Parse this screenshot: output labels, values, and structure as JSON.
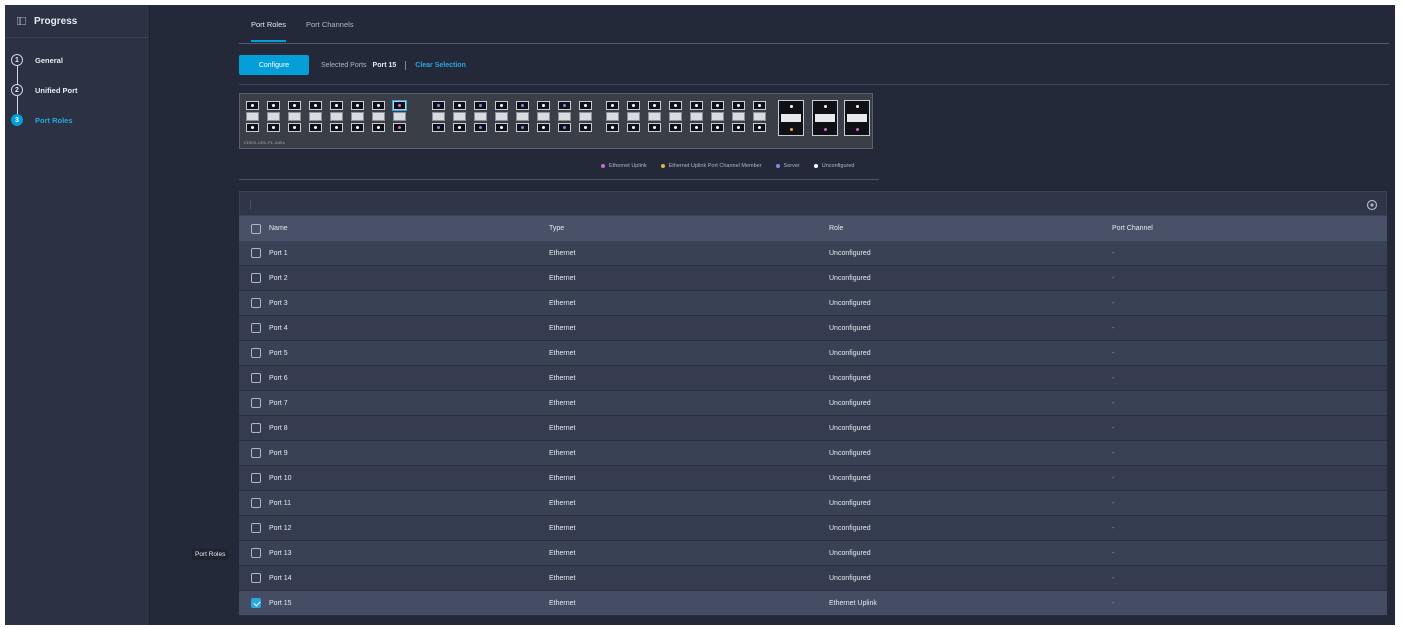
{
  "sidebar": {
    "title": "Progress",
    "steps": [
      {
        "num": "1",
        "label": "General"
      },
      {
        "num": "2",
        "label": "Unified Port"
      },
      {
        "num": "3",
        "label": "Port Roles"
      }
    ]
  },
  "tabs": [
    {
      "label": "Port Roles"
    },
    {
      "label": "Port Channels"
    }
  ],
  "toolbar": {
    "configure_label": "Configure",
    "selected_label": "Selected Ports",
    "selected_value": "Port 15",
    "clear_label": "Clear Selection"
  },
  "switch": {
    "model": "CISCO-UCS-FI-6454"
  },
  "legend": [
    {
      "label": "Ethernet Uplink",
      "color": "#c86dd7"
    },
    {
      "label": "Ethernet Uplink Port Channel Member",
      "color": "#e0b64a"
    },
    {
      "label": "Server",
      "color": "#7b8fe8"
    },
    {
      "label": "Unconfigured",
      "color": "#ffffff"
    }
  ],
  "table": {
    "headers": {
      "name": "Name",
      "type": "Type",
      "role": "Role",
      "port_channel": "Port Channel"
    },
    "rows": [
      {
        "name": "Port 1",
        "type": "Ethernet",
        "role": "Unconfigured",
        "pc": "-",
        "checked": false
      },
      {
        "name": "Port 2",
        "type": "Ethernet",
        "role": "Unconfigured",
        "pc": "-",
        "checked": false
      },
      {
        "name": "Port 3",
        "type": "Ethernet",
        "role": "Unconfigured",
        "pc": "-",
        "checked": false
      },
      {
        "name": "Port 4",
        "type": "Ethernet",
        "role": "Unconfigured",
        "pc": "-",
        "checked": false
      },
      {
        "name": "Port 5",
        "type": "Ethernet",
        "role": "Unconfigured",
        "pc": "-",
        "checked": false
      },
      {
        "name": "Port 6",
        "type": "Ethernet",
        "role": "Unconfigured",
        "pc": "-",
        "checked": false
      },
      {
        "name": "Port 7",
        "type": "Ethernet",
        "role": "Unconfigured",
        "pc": "-",
        "checked": false
      },
      {
        "name": "Port 8",
        "type": "Ethernet",
        "role": "Unconfigured",
        "pc": "-",
        "checked": false
      },
      {
        "name": "Port 9",
        "type": "Ethernet",
        "role": "Unconfigured",
        "pc": "-",
        "checked": false
      },
      {
        "name": "Port 10",
        "type": "Ethernet",
        "role": "Unconfigured",
        "pc": "-",
        "checked": false
      },
      {
        "name": "Port 11",
        "type": "Ethernet",
        "role": "Unconfigured",
        "pc": "-",
        "checked": false
      },
      {
        "name": "Port 12",
        "type": "Ethernet",
        "role": "Unconfigured",
        "pc": "-",
        "checked": false
      },
      {
        "name": "Port 13",
        "type": "Ethernet",
        "role": "Unconfigured",
        "pc": "-",
        "checked": false
      },
      {
        "name": "Port 14",
        "type": "Ethernet",
        "role": "Unconfigured",
        "pc": "-",
        "checked": false
      },
      {
        "name": "Port 15",
        "type": "Ethernet",
        "role": "Ethernet Uplink",
        "pc": "-",
        "checked": true
      }
    ]
  },
  "tooltip": "Port Roles"
}
